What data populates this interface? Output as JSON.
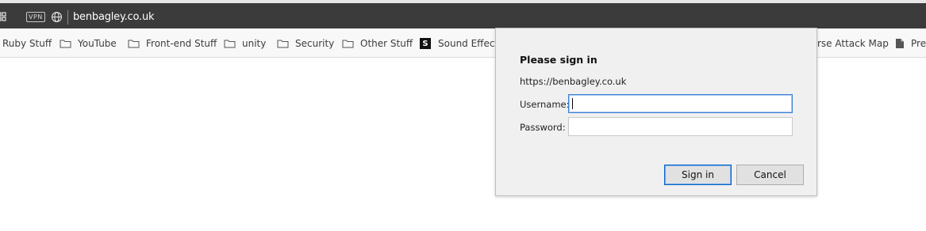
{
  "browser": {
    "vpn_badge": "VPN",
    "url": "benbagley.co.uk"
  },
  "bookmarks": {
    "items": [
      {
        "label": "Ruby Stuff",
        "icon": "folder-icon"
      },
      {
        "label": "YouTube",
        "icon": "folder-icon"
      },
      {
        "label": "Front-end Stuff",
        "icon": "folder-icon"
      },
      {
        "label": "unity",
        "icon": "folder-icon"
      },
      {
        "label": "Security",
        "icon": "folder-icon"
      },
      {
        "label": "Other Stuff",
        "icon": "folder-icon"
      },
      {
        "label": "Sound Effects",
        "icon": "sound-effects-icon",
        "icon_text": "S"
      },
      {
        "label": "rse Attack Map",
        "icon": "none"
      },
      {
        "label": "Pre",
        "icon": "page-icon"
      }
    ]
  },
  "dialog": {
    "title": "Please sign in",
    "origin": "https://benbagley.co.uk",
    "username_label": "Username:",
    "password_label": "Password:",
    "username_value": "",
    "password_value": "",
    "sign_in_label": "Sign in",
    "cancel_label": "Cancel"
  },
  "colors": {
    "address_bar_bg": "#3b3b3b",
    "focus_border": "#3c7fd8",
    "dialog_bg": "#f0f0f0"
  }
}
